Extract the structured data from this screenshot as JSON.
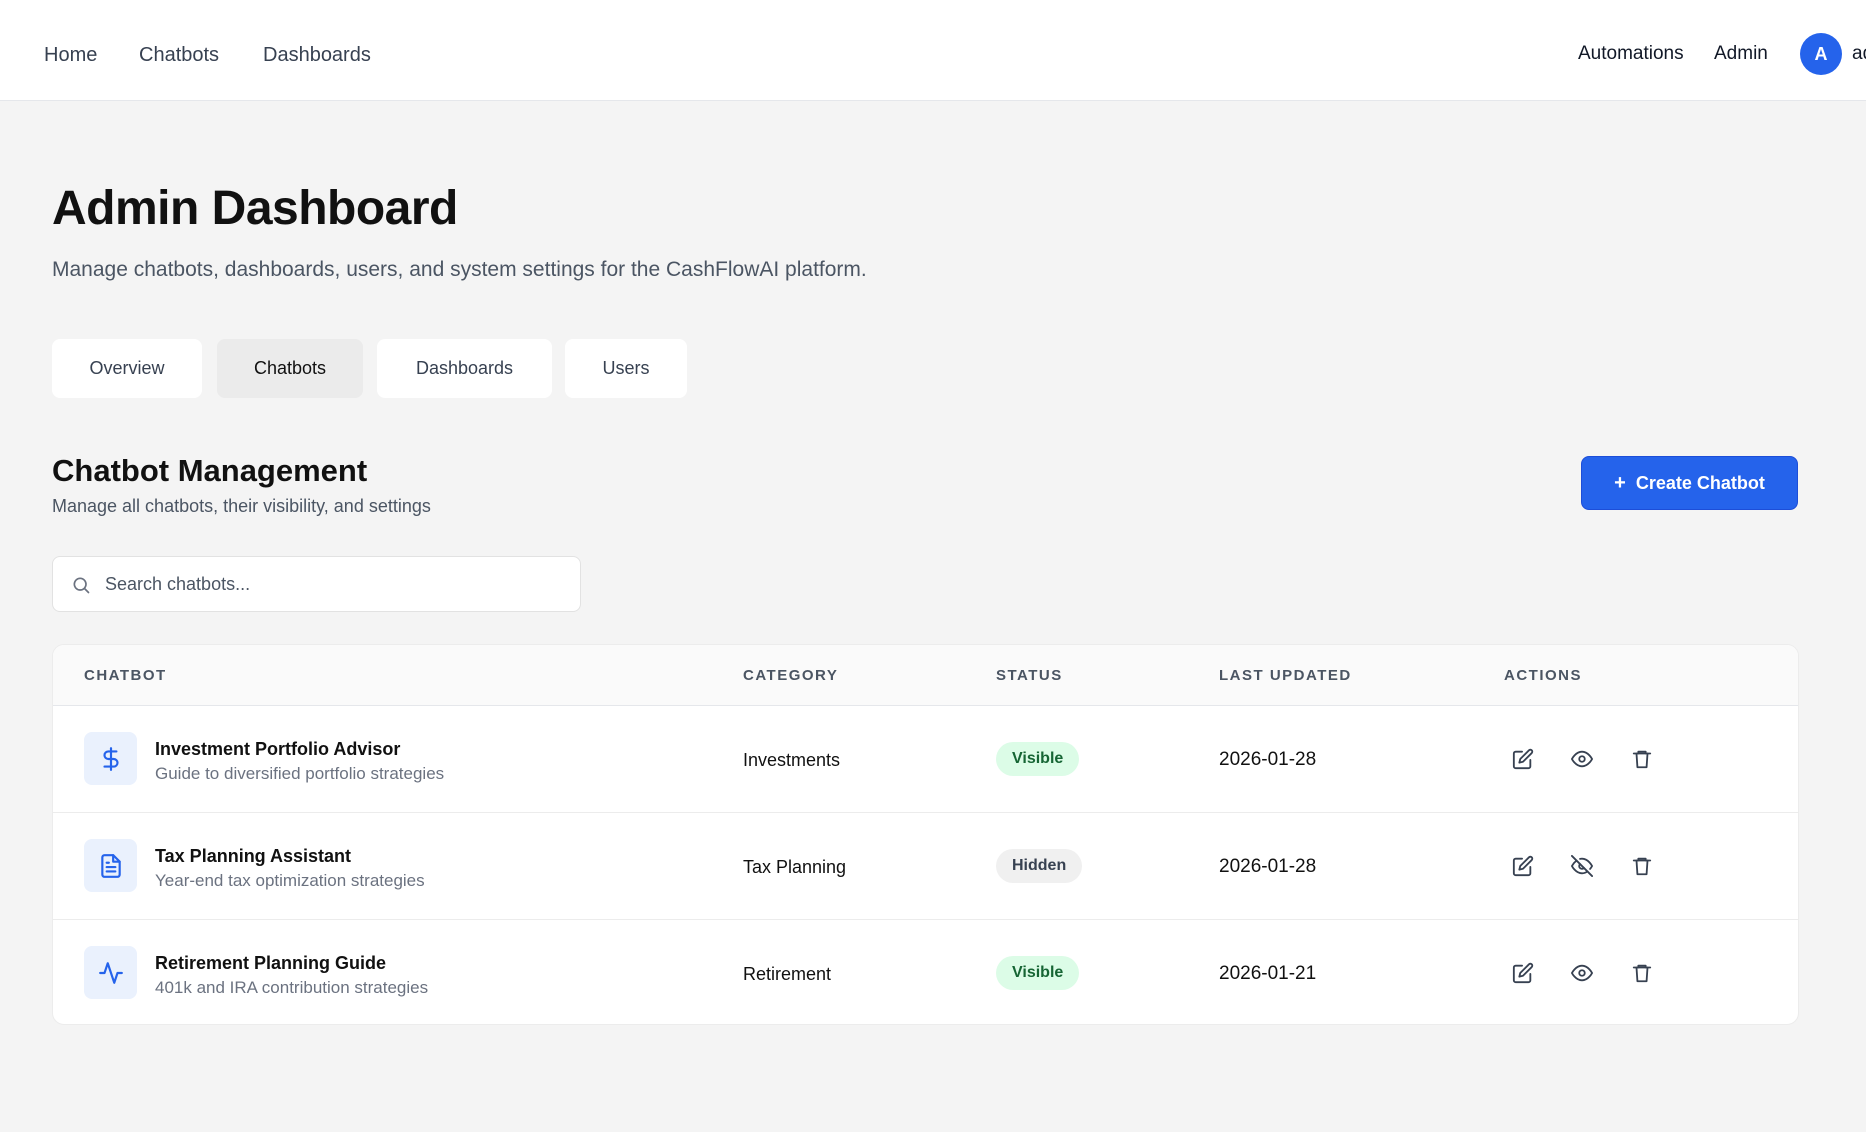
{
  "nav": {
    "left": [
      "Home",
      "Chatbots",
      "Dashboards"
    ],
    "right": [
      "Automations",
      "Admin"
    ],
    "avatar_initial": "A",
    "user_name": "ad"
  },
  "header": {
    "title": "Admin Dashboard",
    "subtitle": "Manage chatbots, dashboards, users, and system settings for the CashFlowAI platform."
  },
  "tabs": [
    {
      "label": "Overview"
    },
    {
      "label": "Chatbots"
    },
    {
      "label": "Dashboards"
    },
    {
      "label": "Users"
    }
  ],
  "active_tab": "Chatbots",
  "section": {
    "title": "Chatbot Management",
    "subtitle": "Manage all chatbots, their visibility, and settings",
    "create_plus": "+",
    "create_label": "Create Chatbot"
  },
  "search": {
    "placeholder": "Search chatbots...",
    "value": ""
  },
  "table": {
    "columns": [
      "CHATBOT",
      "CATEGORY",
      "STATUS",
      "LAST UPDATED",
      "ACTIONS"
    ],
    "rows": [
      {
        "icon": "dollar-icon",
        "name": "Investment Portfolio Advisor",
        "description": "Guide to diversified portfolio strategies",
        "category": "Investments",
        "status": "Visible",
        "updated": "2026-01-28",
        "visibility_icon": "eye-icon"
      },
      {
        "icon": "document-icon",
        "name": "Tax Planning Assistant",
        "description": "Year-end tax optimization strategies",
        "category": "Tax Planning",
        "status": "Hidden",
        "updated": "2026-01-28",
        "visibility_icon": "eye-off-icon"
      },
      {
        "icon": "activity-icon",
        "name": "Retirement Planning Guide",
        "description": "401k and IRA contribution strategies",
        "category": "Retirement",
        "status": "Visible",
        "updated": "2026-01-21",
        "visibility_icon": "eye-icon"
      }
    ]
  },
  "colors": {
    "accent": "#2563eb",
    "visible_badge_bg": "#dcfce7",
    "visible_badge_text": "#166534",
    "hidden_badge_bg": "#f0f0f0",
    "page_bg": "#f4f4f4"
  }
}
